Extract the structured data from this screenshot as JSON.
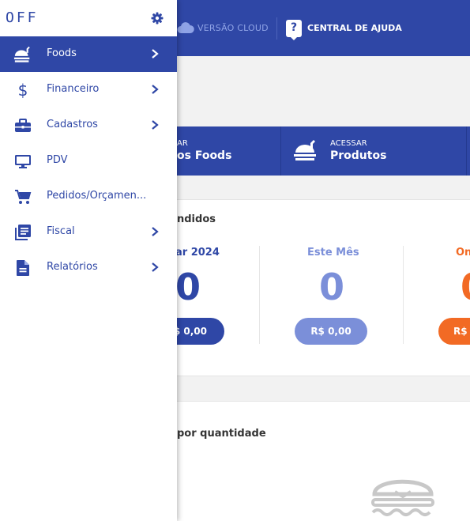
{
  "topbar": {
    "cloud_label": "VERSÃO CLOUD",
    "help_icon": "question-icon",
    "help_label": "CENTRAL DE AJUDA"
  },
  "quick_actions": [
    {
      "small": "AR",
      "big": "os Foods"
    },
    {
      "small": "ACESSAR",
      "big": "Produtos"
    }
  ],
  "sales": {
    "title": "ndidos",
    "columns": [
      {
        "title": "ar 2024",
        "value": "0",
        "amount": "$ 0,00"
      },
      {
        "title": "Este Mês",
        "value": "0",
        "amount": "R$ 0,00"
      },
      {
        "title": "On",
        "value": "0",
        "amount": "R$"
      }
    ]
  },
  "by_quantity": {
    "title": "por quantidade"
  },
  "sidebar": {
    "brand": "OFF",
    "items": [
      {
        "label": "Foods",
        "icon": "food-tray-icon",
        "chevron": true
      },
      {
        "label": "Financeiro",
        "icon": "dollar-icon",
        "chevron": true
      },
      {
        "label": "Cadastros",
        "icon": "briefcase-icon",
        "chevron": true
      },
      {
        "label": "PDV",
        "icon": "monitor-icon",
        "chevron": false
      },
      {
        "label": "Pedidos/Orçamen...",
        "icon": "cart-icon",
        "chevron": false
      },
      {
        "label": "Fiscal",
        "icon": "library-books-icon",
        "chevron": true
      },
      {
        "label": "Relatórios",
        "icon": "document-icon",
        "chevron": true
      }
    ]
  },
  "colors": {
    "primary": "#2f47a6",
    "light_blue": "#7b8fd9",
    "orange": "#f26a24"
  }
}
